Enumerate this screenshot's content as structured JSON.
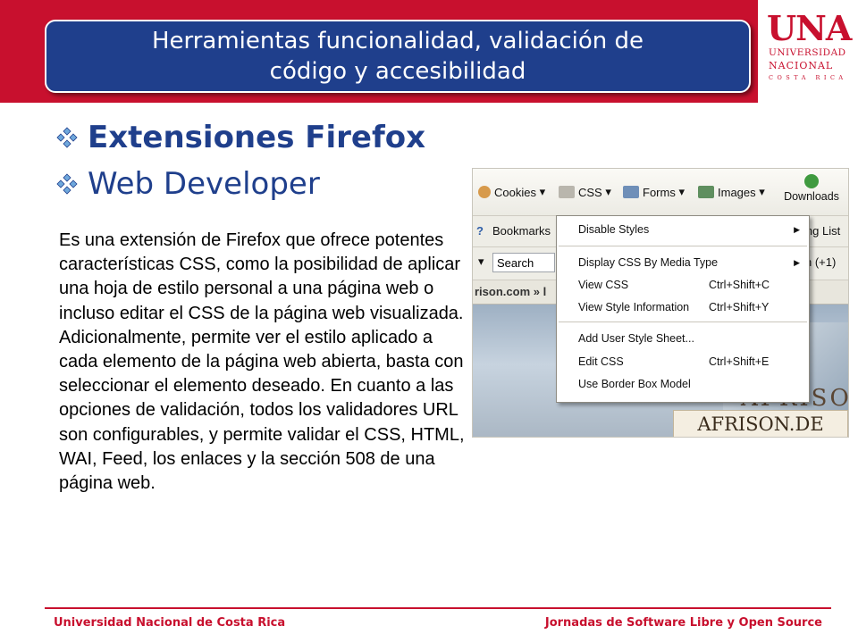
{
  "header": {
    "title_line1": "Herramientas funcionalidad, validación de",
    "title_line2": "código y accesibilidad"
  },
  "logo": {
    "mark": "UNA",
    "line1": "UNIVERSIDAD",
    "line2": "NACIONAL",
    "line3": "COSTA RICA"
  },
  "bullets": [
    {
      "text": "Extensiones Firefox"
    },
    {
      "text": "Web Developer"
    }
  ],
  "body": {
    "paragraph": "Es una extensión de Firefox que ofrece potentes características CSS, como la posibilidad de aplicar una hoja de estilo personal a una página web o incluso editar el CSS de la página web visualizada. Adicionalmente, permite ver el estilo aplicado a cada elemento de la página web abierta, basta con seleccionar el elemento deseado. En cuanto a las opciones de validación, todos los validadores URL son configurables, y permite validar el CSS, HTML, WAI, Feed, los enlaces y la sección 508 de una página web."
  },
  "screenshot": {
    "toolbar": [
      "Cookies",
      "CSS",
      "Forms",
      "Images"
    ],
    "downloads": "Downloads",
    "bookmarks": "Bookmarks",
    "search": "Search",
    "right_text1": "ing List",
    "right_text2": "n (+1)",
    "url_text": "rison.com » l",
    "menu": {
      "disable_styles": "Disable Styles",
      "display_css": "Display CSS By Media Type",
      "view_css": "View CSS",
      "view_css_sc": "Ctrl+Shift+C",
      "view_style": "View Style Information",
      "view_style_sc": "Ctrl+Shift+Y",
      "add_user": "Add User Style Sheet...",
      "edit_css": "Edit CSS",
      "edit_css_sc": "Ctrl+Shift+E",
      "border_box": "Use Border Box Model"
    },
    "afr_big": "AFRISO",
    "afr_label": "AFRISON.DE"
  },
  "footer": {
    "left": "Universidad Nacional de Costa Rica",
    "right": "Jornadas de Software Libre y Open Source"
  },
  "colors": {
    "brand_red": "#c8102e",
    "title_blue": "#1f3f8c"
  }
}
